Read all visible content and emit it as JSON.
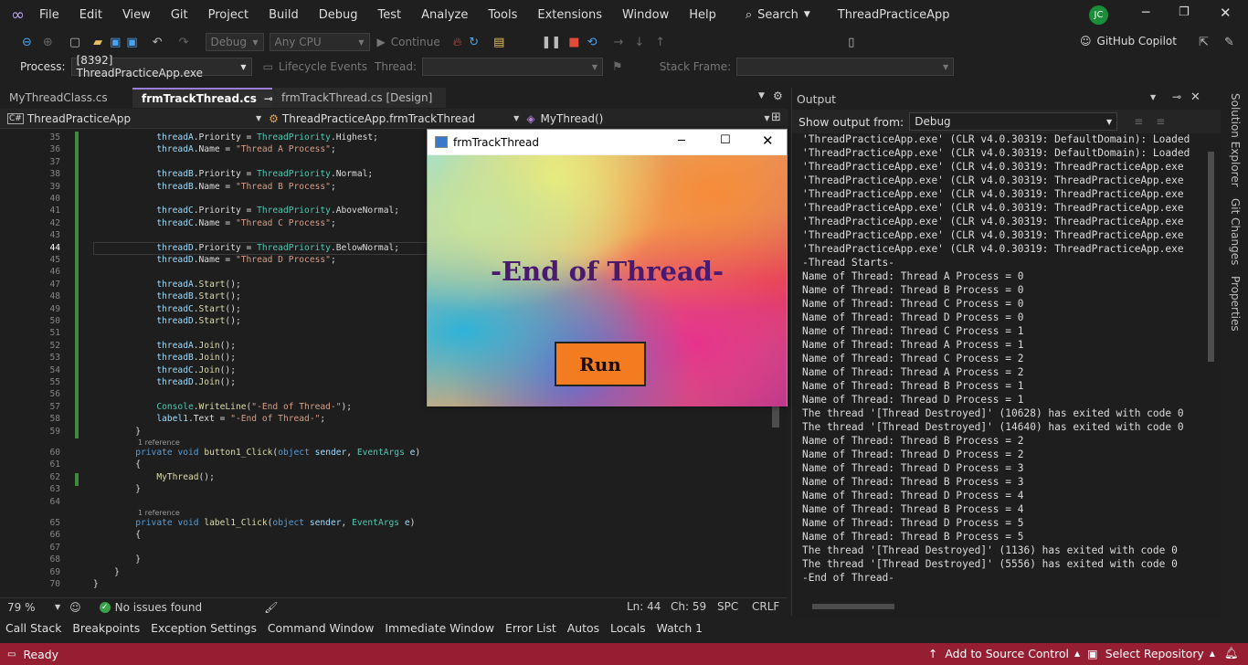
{
  "menu": [
    "File",
    "Edit",
    "View",
    "Git",
    "Project",
    "Build",
    "Debug",
    "Test",
    "Analyze",
    "Tools",
    "Extensions",
    "Window",
    "Help"
  ],
  "search_label": "Search",
  "solution_title": "ThreadPracticeApp",
  "user_initials": "JC",
  "toolbar": {
    "config": "Debug",
    "platform": "Any CPU",
    "continue": "Continue",
    "copilot": "GitHub Copilot"
  },
  "debugbar": {
    "process_label": "Process:",
    "process_value": "[8392] ThreadPracticeApp.exe",
    "lifecycle": "Lifecycle Events",
    "thread_label": "Thread:",
    "stackframe_label": "Stack Frame:"
  },
  "tabs": [
    "MyThreadClass.cs",
    "frmTrackThread.cs",
    "frmTrackThread.cs [Design]"
  ],
  "nav": {
    "project": "ThreadPracticeApp",
    "class": "ThreadPracticeApp.frmTrackThread",
    "member": "MyThread()"
  },
  "code_lines": [
    {
      "n": "35",
      "c": "            threadA.Priority = ThreadPriority.Highest;"
    },
    {
      "n": "36",
      "c": "            threadA.Name = \"Thread A Process\";"
    },
    {
      "n": "37",
      "c": ""
    },
    {
      "n": "38",
      "c": "            threadB.Priority = ThreadPriority.Normal;"
    },
    {
      "n": "39",
      "c": "            threadB.Name = \"Thread B Process\";"
    },
    {
      "n": "40",
      "c": ""
    },
    {
      "n": "41",
      "c": "            threadC.Priority = ThreadPriority.AboveNormal;"
    },
    {
      "n": "42",
      "c": "            threadC.Name = \"Thread C Process\";"
    },
    {
      "n": "43",
      "c": ""
    },
    {
      "n": "44",
      "c": "            threadD.Priority = ThreadPriority.BelowNormal;"
    },
    {
      "n": "45",
      "c": "            threadD.Name = \"Thread D Process\";"
    },
    {
      "n": "46",
      "c": ""
    },
    {
      "n": "47",
      "c": "            threadA.Start();"
    },
    {
      "n": "48",
      "c": "            threadB.Start();"
    },
    {
      "n": "49",
      "c": "            threadC.Start();"
    },
    {
      "n": "50",
      "c": "            threadD.Start();"
    },
    {
      "n": "51",
      "c": ""
    },
    {
      "n": "52",
      "c": "            threadA.Join();"
    },
    {
      "n": "53",
      "c": "            threadB.Join();"
    },
    {
      "n": "54",
      "c": "            threadC.Join();"
    },
    {
      "n": "55",
      "c": "            threadD.Join();"
    },
    {
      "n": "56",
      "c": ""
    },
    {
      "n": "57",
      "c": "            Console.WriteLine(\"-End of Thread-\");"
    },
    {
      "n": "58",
      "c": "            label1.Text = \"-End of Thread-\";"
    },
    {
      "n": "59",
      "c": "        }"
    },
    {
      "n": "",
      "c": "1 reference"
    },
    {
      "n": "60",
      "c": "        private void button1_Click(object sender, EventArgs e)"
    },
    {
      "n": "61",
      "c": "        {"
    },
    {
      "n": "62",
      "c": "            MyThread();"
    },
    {
      "n": "63",
      "c": "        }"
    },
    {
      "n": "64",
      "c": ""
    },
    {
      "n": "",
      "c": "1 reference"
    },
    {
      "n": "65",
      "c": "        private void label1_Click(object sender, EventArgs e)"
    },
    {
      "n": "66",
      "c": "        {"
    },
    {
      "n": "67",
      "c": ""
    },
    {
      "n": "68",
      "c": "        }"
    },
    {
      "n": "69",
      "c": "    }"
    },
    {
      "n": "70",
      "c": "}"
    }
  ],
  "editor_status": {
    "zoom": "79 %",
    "issues": "No issues found",
    "line": "Ln: 44",
    "col": "Ch: 59",
    "spc": "SPC",
    "crlf": "CRLF"
  },
  "output": {
    "title": "Output",
    "show_from_label": "Show output from:",
    "source": "Debug",
    "lines": [
      "'ThreadPracticeApp.exe' (CLR v4.0.30319: DefaultDomain): Loaded",
      "'ThreadPracticeApp.exe' (CLR v4.0.30319: DefaultDomain): Loaded",
      "'ThreadPracticeApp.exe' (CLR v4.0.30319: ThreadPracticeApp.exe",
      "'ThreadPracticeApp.exe' (CLR v4.0.30319: ThreadPracticeApp.exe",
      "'ThreadPracticeApp.exe' (CLR v4.0.30319: ThreadPracticeApp.exe",
      "'ThreadPracticeApp.exe' (CLR v4.0.30319: ThreadPracticeApp.exe",
      "'ThreadPracticeApp.exe' (CLR v4.0.30319: ThreadPracticeApp.exe",
      "'ThreadPracticeApp.exe' (CLR v4.0.30319: ThreadPracticeApp.exe",
      "'ThreadPracticeApp.exe' (CLR v4.0.30319: ThreadPracticeApp.exe",
      "-Thread Starts-",
      "Name of Thread: Thread A Process = 0",
      "Name of Thread: Thread B Process = 0",
      "Name of Thread: Thread C Process = 0",
      "Name of Thread: Thread D Process = 0",
      "Name of Thread: Thread C Process = 1",
      "Name of Thread: Thread A Process = 1",
      "Name of Thread: Thread C Process = 2",
      "Name of Thread: Thread A Process = 2",
      "Name of Thread: Thread B Process = 1",
      "Name of Thread: Thread D Process = 1",
      "The thread '[Thread Destroyed]' (10628) has exited with code 0",
      "The thread '[Thread Destroyed]' (14640) has exited with code 0",
      "Name of Thread: Thread B Process = 2",
      "Name of Thread: Thread D Process = 2",
      "Name of Thread: Thread D Process = 3",
      "Name of Thread: Thread B Process = 3",
      "Name of Thread: Thread D Process = 4",
      "Name of Thread: Thread B Process = 4",
      "Name of Thread: Thread D Process = 5",
      "Name of Thread: Thread B Process = 5",
      "The thread '[Thread Destroyed]' (1136) has exited with code 0",
      "The thread '[Thread Destroyed]' (5556) has exited with code 0",
      "-End of Thread-"
    ]
  },
  "side_tabs": [
    "Solution Explorer",
    "Git Changes",
    "Properties"
  ],
  "bottom_tabs": [
    "Call Stack",
    "Breakpoints",
    "Exception Settings",
    "Command Window",
    "Immediate Window",
    "Error List",
    "Autos",
    "Locals",
    "Watch 1"
  ],
  "statusbar": {
    "ready": "Ready",
    "source_control": "Add to Source Control",
    "repo": "Select Repository"
  },
  "form": {
    "title": "frmTrackThread",
    "label": "-End of Thread-",
    "button": "Run"
  },
  "colors": {
    "accent": "#9a7ed8",
    "statusbar": "#951e33",
    "run_button": "#f37c20",
    "label": "#4a1a6e"
  }
}
